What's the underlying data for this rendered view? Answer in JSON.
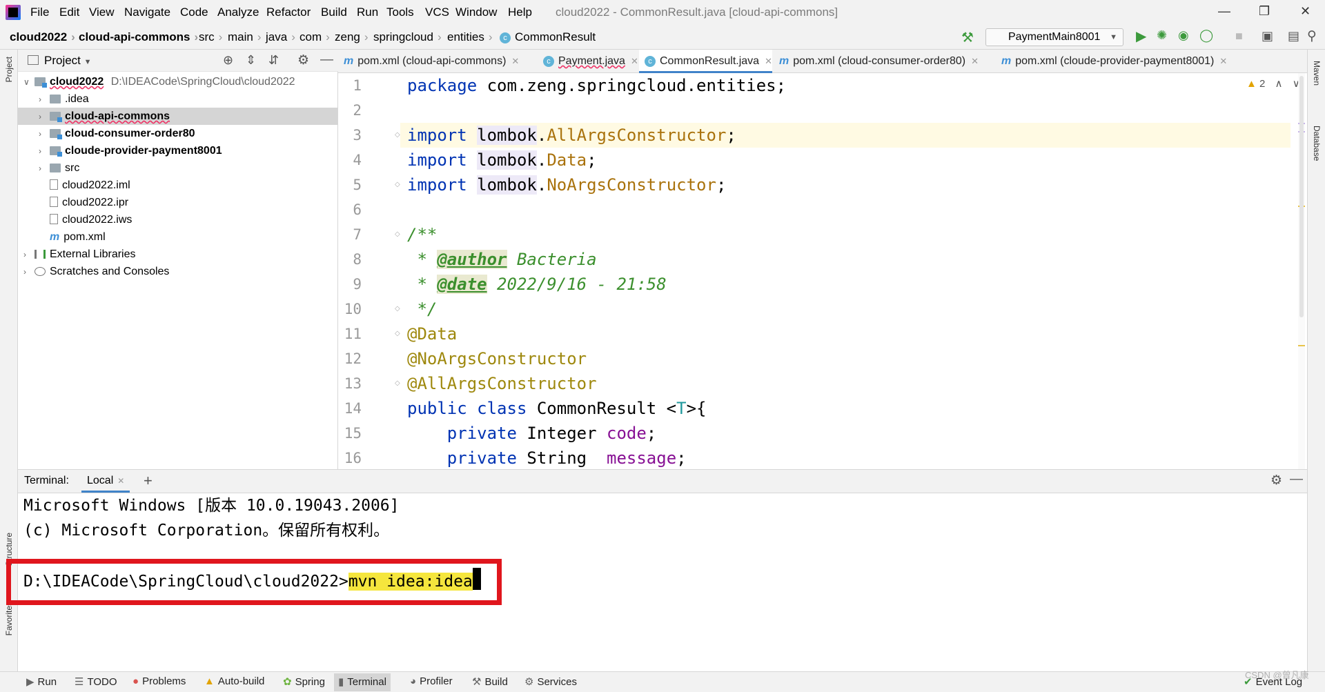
{
  "window": {
    "title": "cloud2022 - CommonResult.java [cloud-api-commons]",
    "menu": [
      "File",
      "Edit",
      "View",
      "Navigate",
      "Code",
      "Analyze",
      "Refactor",
      "Build",
      "Run",
      "Tools",
      "VCS",
      "Window",
      "Help"
    ]
  },
  "breadcrumb": [
    "cloud2022",
    "cloud-api-commons",
    "src",
    "main",
    "java",
    "com",
    "zeng",
    "springcloud",
    "entities",
    "CommonResult"
  ],
  "toolbar": {
    "run_config": "PaymentMain8001"
  },
  "project_panel": {
    "title": "Project",
    "root": {
      "name": "cloud2022",
      "path": "D:\\IDEACode\\SpringCloud\\cloud2022"
    },
    "items": [
      ".idea",
      "cloud-api-commons",
      "cloud-consumer-order80",
      "cloude-provider-payment8001",
      "src",
      "cloud2022.iml",
      "cloud2022.ipr",
      "cloud2022.iws",
      "pom.xml"
    ],
    "external": "External Libraries",
    "scratches": "Scratches and Consoles"
  },
  "editor_tabs": [
    {
      "label": "pom.xml (cloud-api-commons)",
      "icon": "maven-icon"
    },
    {
      "label": "Payment.java",
      "icon": "class-icon"
    },
    {
      "label": "CommonResult.java",
      "icon": "class-icon",
      "active": true
    },
    {
      "label": "pom.xml (cloud-consumer-order80)",
      "icon": "maven-icon"
    },
    {
      "label": "pom.xml (cloude-provider-payment8001)",
      "icon": "maven-icon"
    }
  ],
  "editor": {
    "warnings": "2",
    "line_numbers": [
      "1",
      "2",
      "3",
      "4",
      "5",
      "6",
      "7",
      "8",
      "9",
      "10",
      "11",
      "12",
      "13",
      "14",
      "15",
      "16"
    ],
    "code": {
      "l1_kw": "package",
      "l1_rest": " com.zeng.springcloud.entities;",
      "l3_kw": "import",
      "l3_pkg": "lombok",
      "l3_cls": "AllArgsConstructor",
      "l4_kw": "import",
      "l4_pkg": "lombok",
      "l4_cls": "Data",
      "l5_kw": "import",
      "l5_pkg": "lombok",
      "l5_cls": "NoArgsConstructor",
      "l7": "/**",
      "l8_star": " * ",
      "l8_tag": "@author",
      "l8_val": " Bacteria",
      "l9_star": " * ",
      "l9_tag": "@date",
      "l9_val": " 2022/9/16 - 21:58",
      "l10": " */",
      "l11": "@Data",
      "l12": "@NoArgsConstructor",
      "l13": "@AllArgsConstructor",
      "l14_kw": "public class",
      "l14_name": " CommonResult <",
      "l14_t": "T",
      "l14_end": ">{",
      "l15_kw": "private",
      "l15_type": " Integer ",
      "l15_fld": "code",
      "l16_kw": "private",
      "l16_type": " String  ",
      "l16_fld": "message"
    }
  },
  "terminal": {
    "label": "Terminal:",
    "tab": "Local",
    "lines": [
      "Microsoft Windows [版本 10.0.19043.2006]",
      "(c) Microsoft Corporation。保留所有权利。"
    ],
    "prompt": "D:\\IDEACode\\SpringCloud\\cloud2022>",
    "command": "mvn idea:idea"
  },
  "side_tools": {
    "left": [
      "Project",
      "Structure",
      "Favorites"
    ],
    "right": [
      "Maven",
      "Database"
    ]
  },
  "statusbar": {
    "items": [
      "Run",
      "TODO",
      "Problems",
      "Auto-build",
      "Spring",
      "Terminal",
      "Profiler",
      "Build",
      "Services"
    ],
    "event_log": "Event Log",
    "watermark": "CSDN @曾凡康"
  }
}
